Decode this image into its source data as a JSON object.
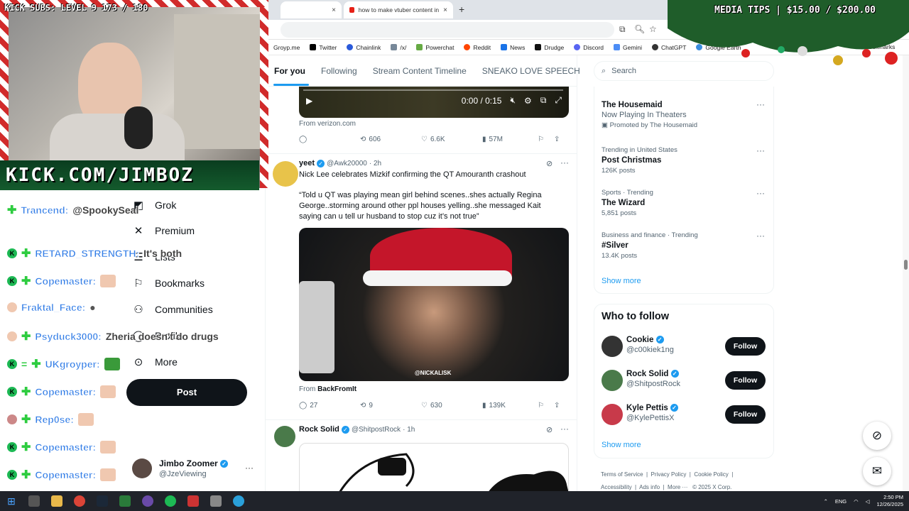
{
  "browser": {
    "tabs": [
      {
        "title": ""
      },
      {
        "title": "how to make vtuber content in"
      }
    ],
    "new_tab": "+",
    "close": "×",
    "bookmarks": [
      "Groyp.me",
      "Twitter",
      "Chainlink",
      "/x/",
      "Powerchat",
      "Reddit",
      "News",
      "Drudge",
      "Discord",
      "Gemini",
      "ChatGPT",
      "Google Earth"
    ],
    "all_bookmarks": "All Bookmarks"
  },
  "overlay": {
    "subs": "KICK SUBS: LEVEL 9 173 / 180",
    "tips": "MEDIA TIPS | $15.00 / $200.00",
    "banner": "KICK.COM/JIMBOZ"
  },
  "chat": [
    {
      "user": "Trancend:",
      "msg": "@SpookySeal"
    },
    {
      "user": "RETARD_STRENGTH:",
      "msg": "It's both"
    },
    {
      "user": "Copemaster:",
      "msg": ""
    },
    {
      "user": "Fraktal_Face:",
      "msg": ""
    },
    {
      "user": "Psyduck3000:",
      "msg": "Zheria doesn't do drugs"
    },
    {
      "user": "UKgroyper:",
      "msg": ""
    },
    {
      "user": "Copemaster:",
      "msg": ""
    },
    {
      "user": "Rep0se:",
      "msg": ""
    },
    {
      "user": "Copemaster:",
      "msg": ""
    },
    {
      "user": "Copemaster:",
      "msg": ""
    }
  ],
  "leftnav": {
    "items": [
      "Grok",
      "Premium",
      "Lists",
      "Bookmarks",
      "Communities",
      "Profile",
      "More"
    ],
    "post": "Post",
    "account_name": "Jimbo Zoomer",
    "account_handle": "@JzeViewing",
    "more_dots": "···"
  },
  "timeline_tabs": [
    "For you",
    "Following",
    "Stream Content Timeline",
    "SNEAKO LOVE SPEECH"
  ],
  "tweet0": {
    "time": "0:00 / 0:15",
    "source": "From verizon.com",
    "retweets": "606",
    "likes": "6.6K",
    "views": "57M"
  },
  "tweet1": {
    "name": "yeet",
    "handle": "@Awk20000",
    "time": "· 2h",
    "text1": "Nick Lee celebrates Mizkif confirming the QT Amouranth crashout",
    "text2": "“Told u QT was playing mean girl behind scenes..shes actually Regina George..storming around other ppl houses yelling..she messaged Kait saying can u tell ur husband to stop cuz it’s not true”",
    "watermark": "@NICKALISK",
    "from_label": "From",
    "from_source": "BackFromIt",
    "replies": "27",
    "retweets": "9",
    "likes": "630",
    "views": "139K"
  },
  "tweet2": {
    "name": "Rock Solid",
    "handle": "@ShitpostRock",
    "time": "· 1h"
  },
  "search": {
    "placeholder": "Search"
  },
  "trends": [
    {
      "cat": "",
      "name": "The Housemaid",
      "count": "Now Playing In Theaters",
      "promo": "Promoted by The Housemaid"
    },
    {
      "cat": "Trending in United States",
      "name": "Post Christmas",
      "count": "126K posts"
    },
    {
      "cat": "Sports · Trending",
      "name": "The Wizard",
      "count": "5,851 posts"
    },
    {
      "cat": "Business and finance · Trending",
      "name": "#Silver",
      "count": "13.4K posts"
    }
  ],
  "show_more": "Show more",
  "who_to_follow": {
    "title": "Who to follow",
    "users": [
      {
        "name": "Cookie",
        "handle": "@c00kiek1ng"
      },
      {
        "name": "Rock Solid",
        "handle": "@ShitpostRock"
      },
      {
        "name": "Kyle Pettis",
        "handle": "@KylePettisX"
      }
    ],
    "follow": "Follow"
  },
  "footer": {
    "links": [
      "Terms of Service",
      "Privacy Policy",
      "Cookie Policy",
      "Accessibility",
      "Ads info",
      "More ···"
    ],
    "copyright": "© 2025 X Corp."
  },
  "taskbar": {
    "lang": "ENG",
    "time": "2:50 PM",
    "date": "12/26/2025"
  }
}
